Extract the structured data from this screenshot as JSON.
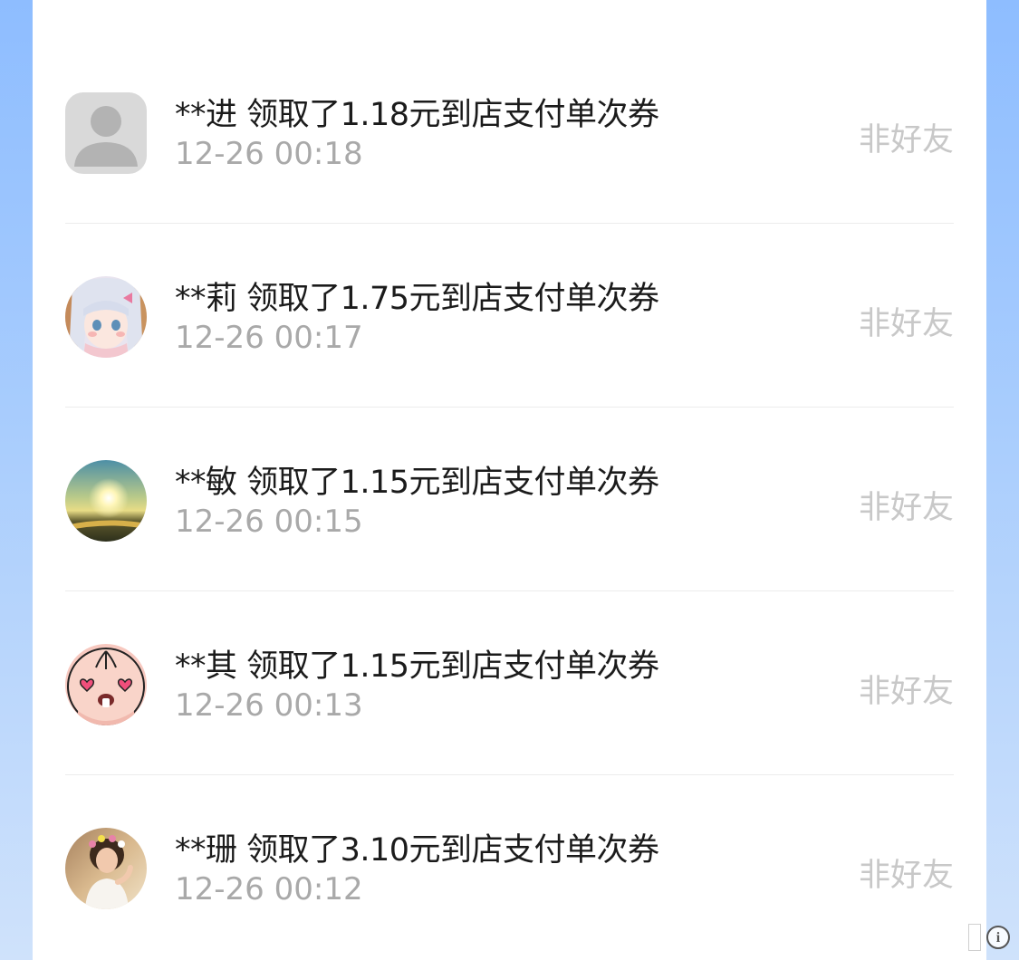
{
  "records": [
    {
      "message": "**进 领取了1.18元到店支付单次券",
      "time": "12-26 00:18",
      "status": "非好友",
      "avatar": "default-avatar-icon"
    },
    {
      "message": "**莉 领取了1.75元到店支付单次券",
      "time": "12-26 00:17",
      "status": "非好友",
      "avatar": "anime-girl-avatar"
    },
    {
      "message": "**敏 领取了1.15元到店支付单次券",
      "time": "12-26 00:15",
      "status": "非好友",
      "avatar": "sunset-landscape-avatar"
    },
    {
      "message": "**其 领取了1.15元到店支付单次券",
      "time": "12-26 00:13",
      "status": "非好友",
      "avatar": "cartoon-face-avatar"
    },
    {
      "message": "**珊 领取了3.10元到店支付单次券",
      "time": "12-26 00:12",
      "status": "非好友",
      "avatar": "portrait-photo-avatar"
    }
  ],
  "colors": {
    "background_top": "#8ebdff",
    "background_bottom": "#cfe2fb",
    "card": "#ffffff",
    "message_text": "#1b1b1b",
    "time_text": "#a9a9a9",
    "status_text": "#c8c8c8"
  }
}
